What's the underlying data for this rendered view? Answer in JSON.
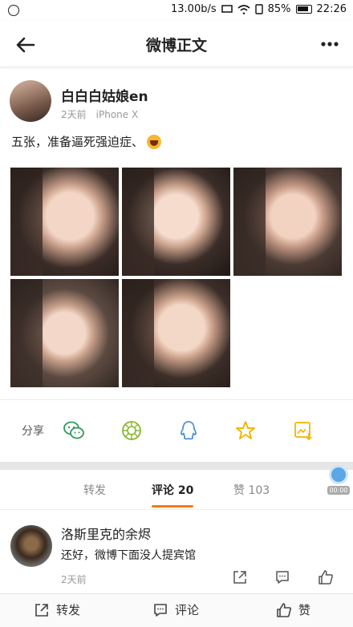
{
  "status_bar": {
    "speed": "13.00b/s",
    "battery": "85%",
    "time": "22:26"
  },
  "header": {
    "title": "微博正文"
  },
  "post": {
    "author": "白白白姑娘en",
    "time": "2天前",
    "device": "iPhone X",
    "text": "五张，准备逼死强迫症、",
    "photo_count": 5
  },
  "share": {
    "label": "分享",
    "icons": [
      "wechat-icon",
      "moments-icon",
      "qq-icon",
      "favorite-star-icon",
      "save-image-icon"
    ]
  },
  "tabs": [
    {
      "label": "转发"
    },
    {
      "label": "评论 20"
    },
    {
      "label": "赞 103"
    }
  ],
  "timer_label": "00:00",
  "comment": {
    "name": "洛斯里克的余烬",
    "text": "还好，微博下面没人提宾馆",
    "time": "2天前"
  },
  "bottom_bar": {
    "repost": "转发",
    "comment": "评论",
    "like": "赞"
  },
  "colors": {
    "accent": "#f57c00",
    "wechat": "#2e9a5a",
    "qq": "#4a90d9",
    "star": "#f5b400"
  }
}
